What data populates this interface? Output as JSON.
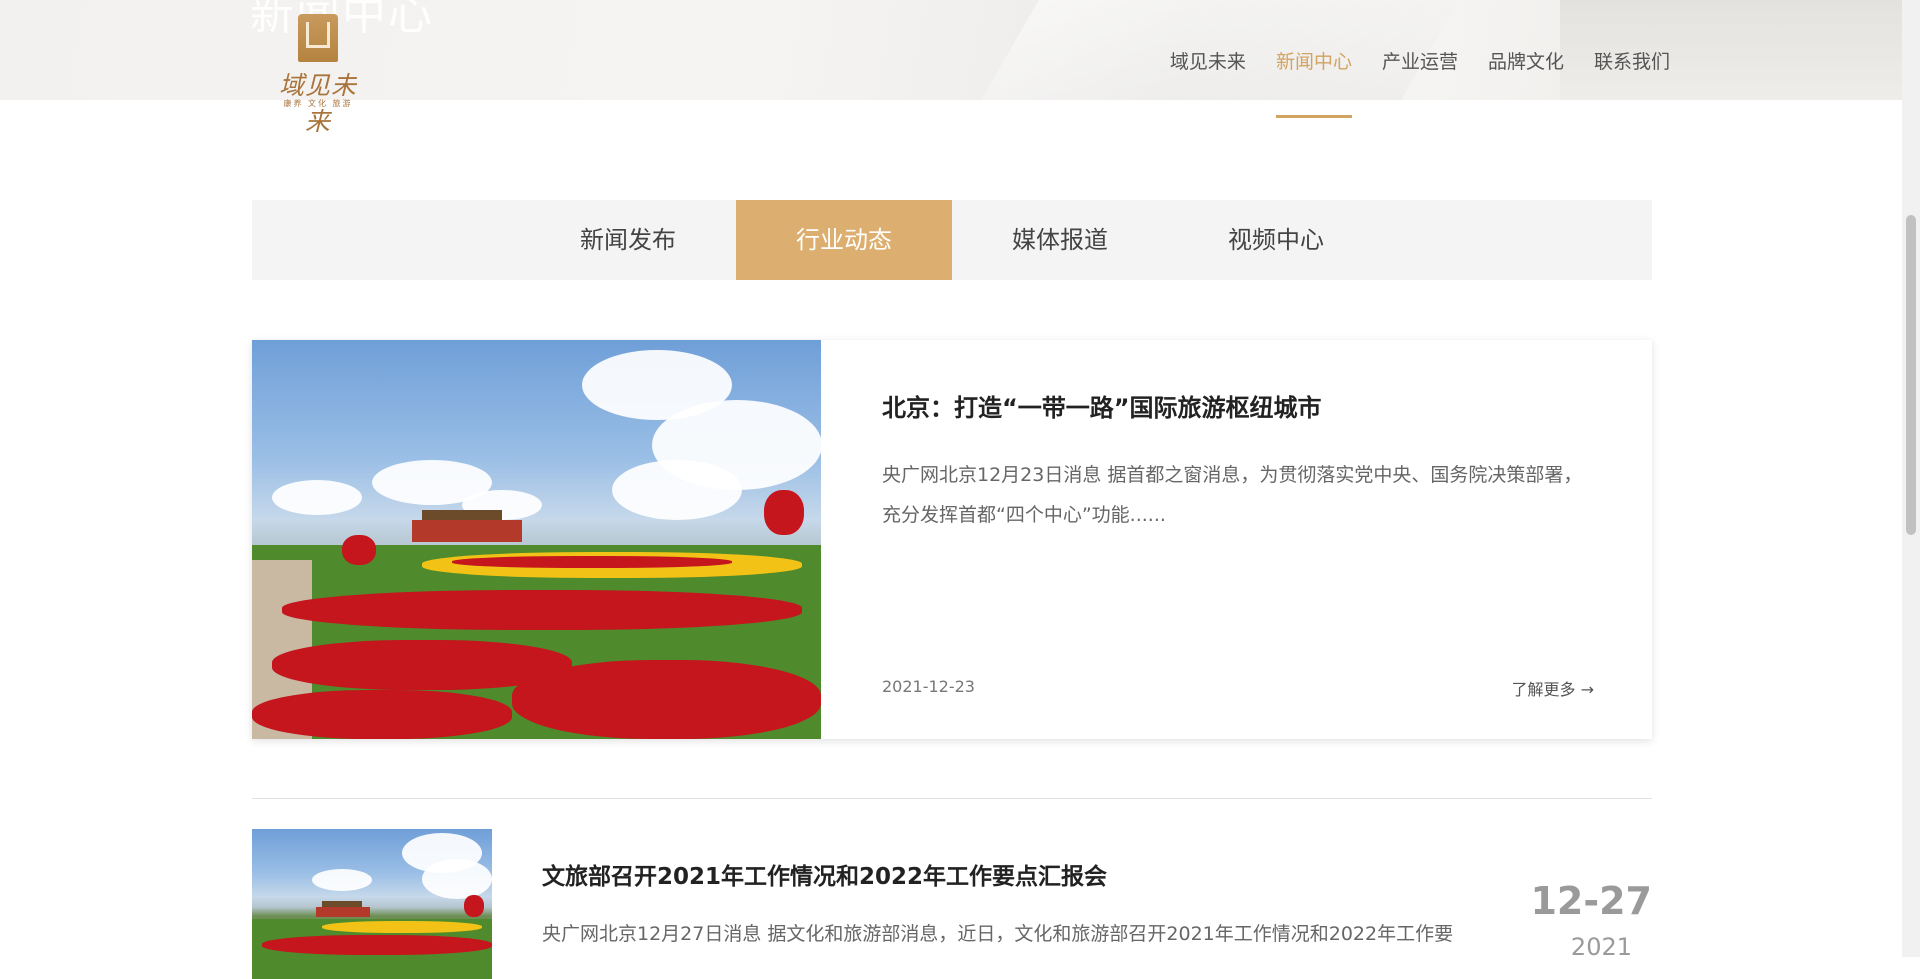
{
  "header": {
    "ghost_title": "新闻中心",
    "logo": {
      "brand": "域见未来",
      "tagline": "康养 文化 旅游"
    },
    "nav": [
      {
        "label": "域见未来",
        "active": false
      },
      {
        "label": "新闻中心",
        "active": true
      },
      {
        "label": "产业运营",
        "active": false
      },
      {
        "label": "品牌文化",
        "active": false
      },
      {
        "label": "联系我们",
        "active": false
      }
    ]
  },
  "tabs": [
    {
      "label": "新闻发布",
      "active": false
    },
    {
      "label": "行业动态",
      "active": true
    },
    {
      "label": "媒体报道",
      "active": false
    },
    {
      "label": "视频中心",
      "active": false
    }
  ],
  "featured": {
    "title": "北京：打造“一带一路”国际旅游枢纽城市",
    "summary": "央广网北京12月23日消息 据首都之窗消息，为贯彻落实党中央、国务院决策部署，充分发挥首都“四个中心”功能......",
    "date": "2021-12-23",
    "more_label": "了解更多 →"
  },
  "list": [
    {
      "title": "文旅部召开2021年工作情况和2022年工作要点汇报会",
      "summary": "央广网北京12月27日消息 据文化和旅游部消息，近日，文化和旅游部召开2021年工作情况和2022年工作要",
      "day": "12-27",
      "year": "2021"
    }
  ],
  "colors": {
    "accent": "#dcae6f",
    "nav_active": "#d3a362"
  }
}
